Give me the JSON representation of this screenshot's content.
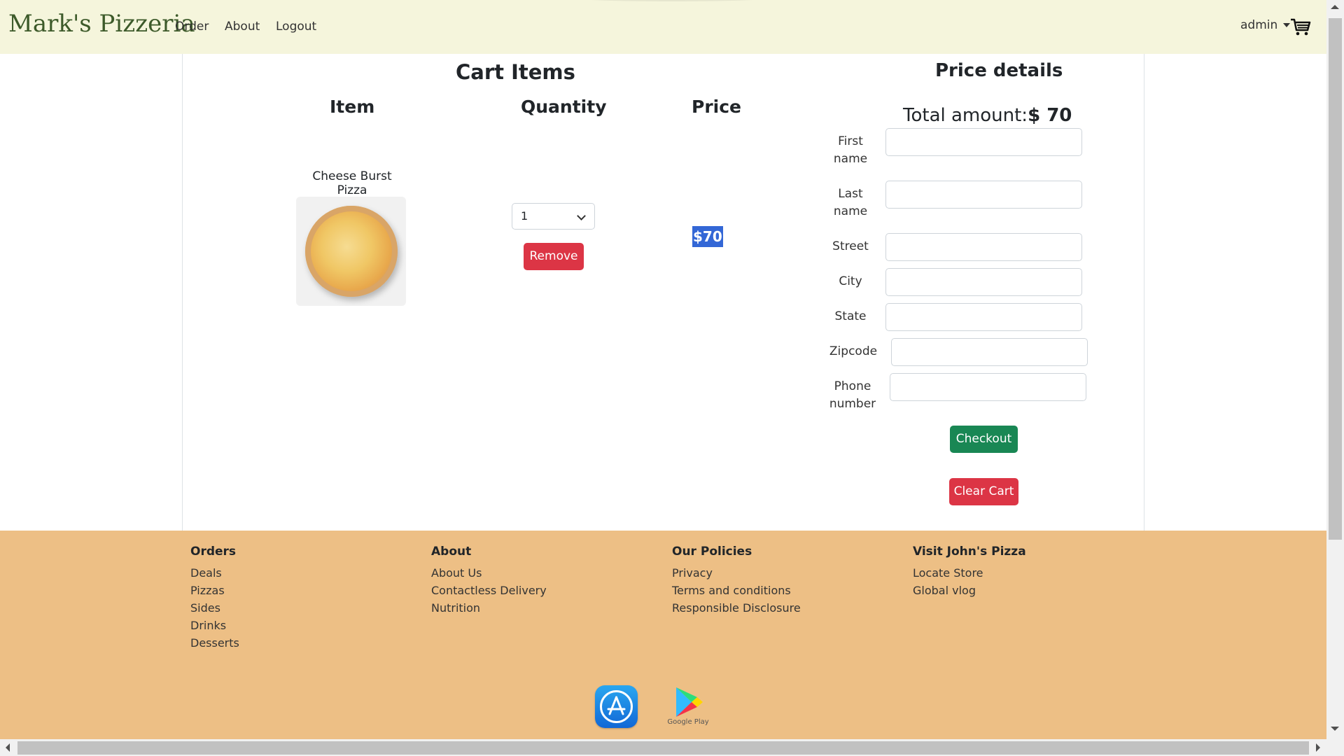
{
  "navbar": {
    "brand": "Mark's Pizzeria",
    "links": [
      "Order",
      "About",
      "Logout"
    ],
    "user": "admin",
    "cart_icon": "shopping-cart-icon"
  },
  "cart": {
    "title": "Cart Items",
    "columns": [
      "Item",
      "Quantity",
      "Price"
    ],
    "items": [
      {
        "name": "Cheese Burst Pizza",
        "quantity": "1",
        "price": "$70",
        "remove_label": "Remove"
      }
    ]
  },
  "price_details": {
    "title": "Price details",
    "total_label": "Total amount:",
    "total_value": "$ 70",
    "fields": {
      "first_name": "First name",
      "last_name": "Last name",
      "street": "Street",
      "city": "City",
      "state": "State",
      "zipcode": "Zipcode",
      "phone": "Phone number"
    },
    "checkout_label": "Checkout",
    "clear_label": "Clear Cart"
  },
  "footer": {
    "columns": [
      {
        "heading": "Orders",
        "links": [
          "Deals",
          "Pizzas",
          "Sides",
          "Drinks",
          "Desserts"
        ]
      },
      {
        "heading": "About",
        "links": [
          "About Us",
          "Contactless Delivery",
          "Nutrition"
        ]
      },
      {
        "heading": "Our Policies",
        "links": [
          "Privacy",
          "Terms and conditions",
          "Responsible Disclosure"
        ]
      },
      {
        "heading": "Visit John's Pizza",
        "links": [
          "Locate Store",
          "Global vlog"
        ]
      }
    ],
    "google_play_label": "Google Play"
  },
  "colors": {
    "navbar_bg": "#f5f5dc",
    "footer_bg": "#edbf85",
    "danger": "#dc3545",
    "success": "#198754",
    "selection": "#3367d6"
  }
}
